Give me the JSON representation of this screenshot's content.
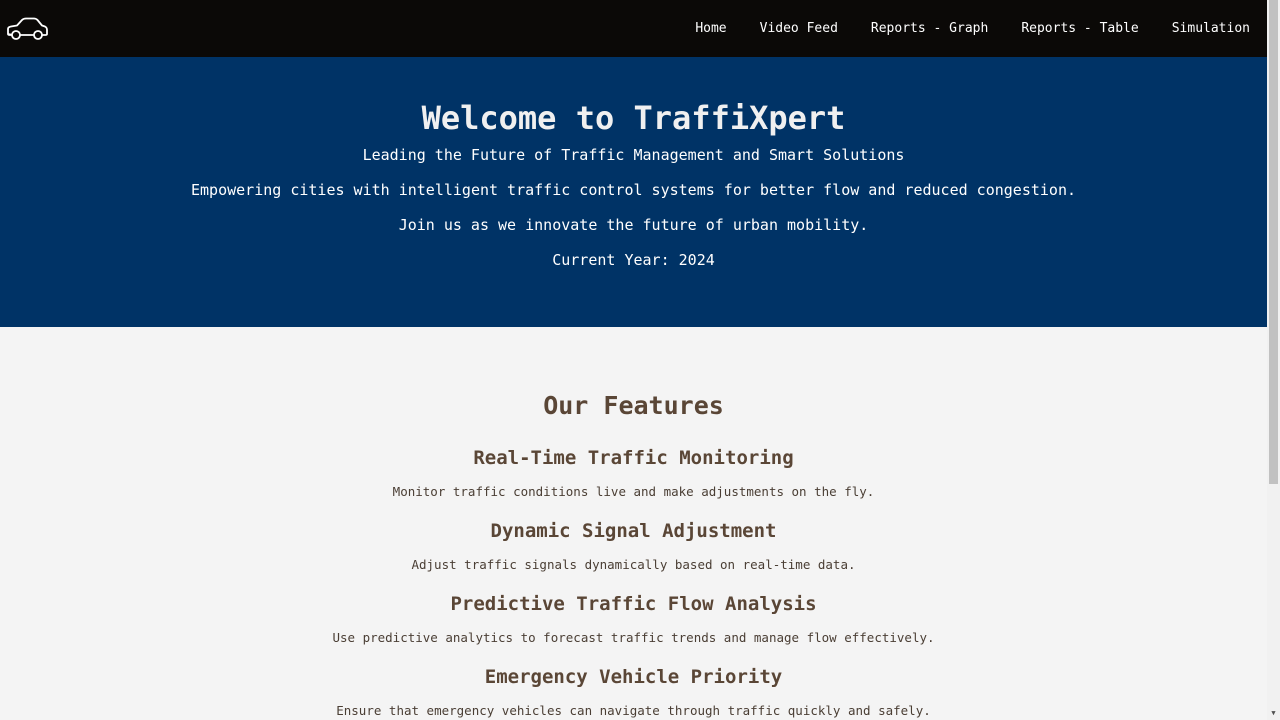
{
  "navbar": {
    "logo_icon": "car-icon",
    "links": [
      "Home",
      "Video Feed",
      "Reports - Graph",
      "Reports - Table",
      "Simulation"
    ]
  },
  "hero": {
    "title": "Welcome to TraffiXpert",
    "subtitle": "Leading the Future of Traffic Management and Smart Solutions",
    "line1": "Empowering cities with intelligent traffic control systems for better flow and reduced congestion.",
    "line2": "Join us as we innovate the future of urban mobility.",
    "year": "Current Year: 2024"
  },
  "features": {
    "title": "Our Features",
    "items": [
      {
        "title": "Real-Time Traffic Monitoring",
        "desc": "Monitor traffic conditions live and make adjustments on the fly."
      },
      {
        "title": "Dynamic Signal Adjustment",
        "desc": "Adjust traffic signals dynamically based on real-time data."
      },
      {
        "title": "Predictive Traffic Flow Analysis",
        "desc": "Use predictive analytics to forecast traffic trends and manage flow effectively."
      },
      {
        "title": "Emergency Vehicle Priority",
        "desc": "Ensure that emergency vehicles can navigate through traffic quickly and safely."
      }
    ]
  },
  "colors": {
    "navbar_bg": "#0b0907",
    "hero_bg": "#003366",
    "page_bg": "#f4f4f4",
    "feature_text": "#5a4636"
  }
}
